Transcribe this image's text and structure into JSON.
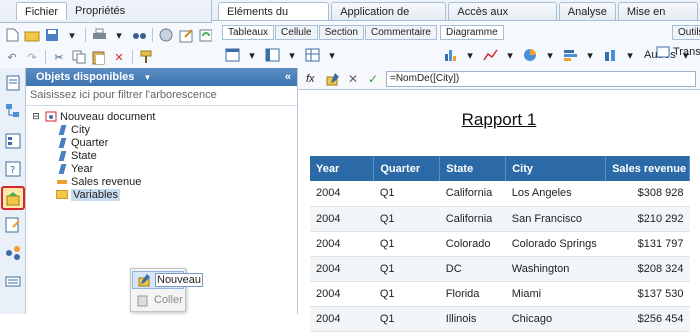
{
  "left_ribbon": {
    "tabs": [
      "Fichier",
      "Propriétés"
    ]
  },
  "main_tabs": [
    "Eléments du rapport",
    "Application de format",
    "Accès aux données",
    "Analyse",
    "Mise en page"
  ],
  "sub_tabs": [
    "Tableaux",
    "Cellule",
    "Section",
    "Commentaire"
  ],
  "sub_tabs2": [
    "Diagramme"
  ],
  "sub_tab_outils": "Outils",
  "autres_label": "Autres",
  "trans_label": "Trans",
  "panel": {
    "title": "Objets disponibles",
    "filter_placeholder": "Saisissez ici pour filtrer l'arborescence",
    "tree": {
      "root": "Nouveau document",
      "items": [
        "City",
        "Quarter",
        "State",
        "Year",
        "Sales revenue",
        "Variables"
      ]
    }
  },
  "context_menu": {
    "nouveau": "Nouveau",
    "coller": "Coller"
  },
  "formula": {
    "fx": "fx",
    "value": "=NomDe([City])"
  },
  "report": {
    "title": "Rapport 1",
    "headers": [
      "Year",
      "Quarter",
      "State",
      "City",
      "Sales revenue"
    ],
    "rows": [
      [
        "2004",
        "Q1",
        "California",
        "Los Angeles",
        "$308 928"
      ],
      [
        "2004",
        "Q1",
        "California",
        "San Francisco",
        "$210 292"
      ],
      [
        "2004",
        "Q1",
        "Colorado",
        "Colorado Springs",
        "$131 797"
      ],
      [
        "2004",
        "Q1",
        "DC",
        "Washington",
        "$208 324"
      ],
      [
        "2004",
        "Q1",
        "Florida",
        "Miami",
        "$137 530"
      ],
      [
        "2004",
        "Q1",
        "Illinois",
        "Chicago",
        "$256 454"
      ]
    ]
  },
  "colors": {
    "header_blue": "#2b6aa6",
    "panel_head": "#3d74b0",
    "highlight": "#d9262c"
  }
}
